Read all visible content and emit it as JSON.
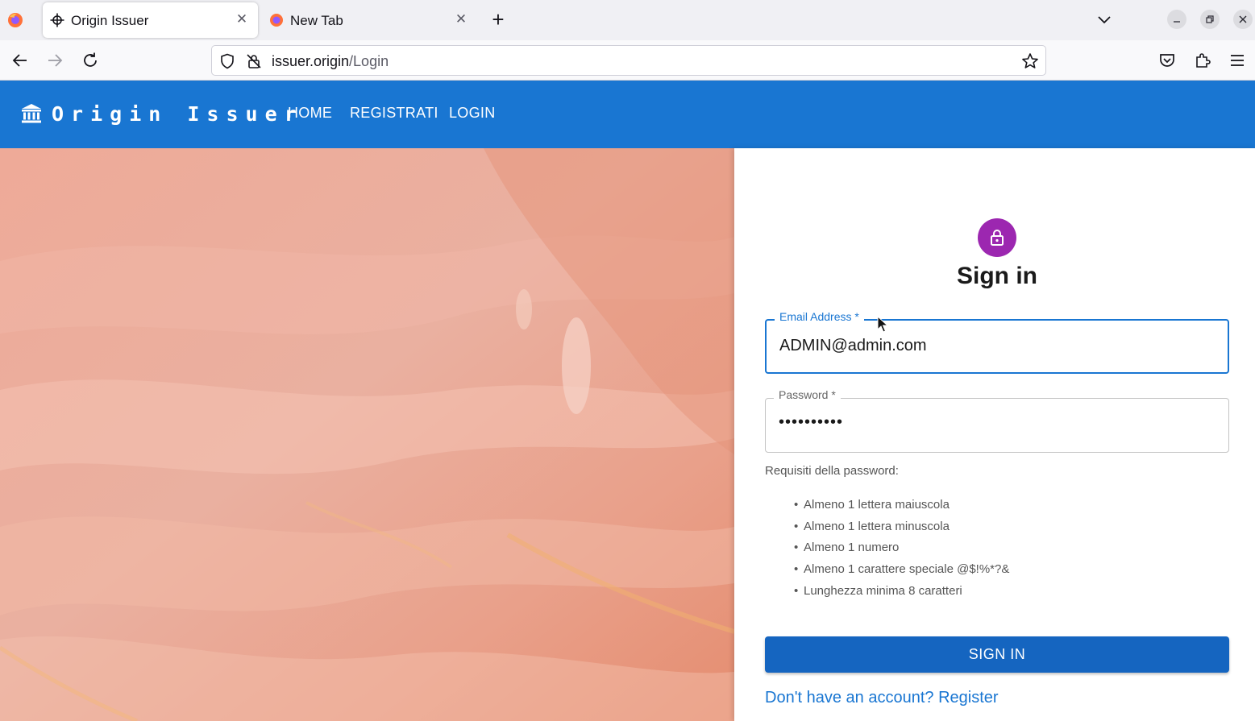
{
  "browser": {
    "tabs": [
      {
        "title": "Origin Issuer",
        "active": true,
        "icon": "crosshair-icon"
      },
      {
        "title": "New Tab",
        "active": false,
        "icon": "firefox-icon"
      }
    ],
    "url_host": "issuer.origin",
    "url_path": "/Login"
  },
  "app": {
    "brand": "Origin Issuer",
    "brand_icon": "bank-icon",
    "nav": [
      "HOME",
      "REGISTRATI",
      "LOGIN"
    ],
    "primary_color": "#1976d2"
  },
  "form": {
    "title": "Sign in",
    "avatar_icon": "lock-icon",
    "avatar_color": "#9c27b0",
    "email_label": "Email Address *",
    "email_value": "ADMIN@admin.com",
    "password_label": "Password *",
    "password_value": "••••••••••",
    "requirements_title": "Requisiti della password:",
    "requirements": [
      "Almeno 1 lettera maiuscola",
      "Almeno 1 lettera minuscola",
      "Almeno 1 numero",
      "Almeno 1 carattere speciale @$!%*?&",
      "Lunghezza minima 8 caratteri"
    ],
    "submit_label": "SIGN IN",
    "register_link": "Don't have an account? Register"
  }
}
